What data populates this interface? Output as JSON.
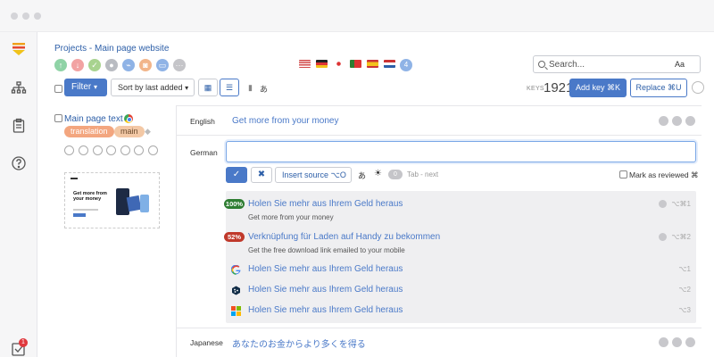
{
  "window": {
    "controls": [
      "close",
      "minimize",
      "maximize"
    ]
  },
  "rail": {
    "icons": [
      "logo-icon",
      "sitemap-icon",
      "clipboard-icon",
      "help-icon",
      "tasks-icon"
    ],
    "tasks_badge": "1"
  },
  "header": {
    "breadcrumb": "Projects - Main page website",
    "action_icons": [
      {
        "name": "upload-icon",
        "glyph": "↑",
        "color": "#8fd3a6"
      },
      {
        "name": "download-icon",
        "glyph": "↓",
        "color": "#f2a3a3"
      },
      {
        "name": "check-icon",
        "glyph": "✓",
        "color": "#a8d38f"
      },
      {
        "name": "user-icon",
        "glyph": "●",
        "color": "#b9bcc2"
      },
      {
        "name": "chart-icon",
        "glyph": "⌁",
        "color": "#8fb3e6"
      },
      {
        "name": "camera-icon",
        "glyph": "◙",
        "color": "#f2b58a"
      },
      {
        "name": "screen-icon",
        "glyph": "▭",
        "color": "#8fb3e6"
      },
      {
        "name": "more-icon",
        "glyph": "···",
        "color": "#c5c5c9"
      }
    ],
    "flags": [
      "us",
      "de",
      "jp",
      "pt",
      "es",
      "nl"
    ],
    "extra_languages": "4",
    "search": {
      "placeholder": "Search...",
      "case_label": "Aa"
    }
  },
  "toolbar": {
    "filter_label": "Filter",
    "sort_label": "Sort by last added",
    "keys_label": "KEYS",
    "keys_count": "1921",
    "add_key_label": "Add key ⌘K",
    "replace_label": "Replace ⌘U"
  },
  "key": {
    "name": "Main page text",
    "tags": [
      "translation",
      "main"
    ],
    "screenshot": {
      "heading": "Get more from your money"
    }
  },
  "translations": {
    "source": {
      "language": "English",
      "text": "Get more from your money"
    },
    "target": {
      "language": "German",
      "value": "",
      "insert_source_label": "Insert source ⌥O",
      "toggle_value": "0",
      "tab_hint": "Tab - next",
      "mark_reviewed_label": "Mark as reviewed ⌘"
    },
    "suggestions": [
      {
        "type": "tm",
        "match": "100%",
        "match_color": "#2e7d32",
        "text": "Holen Sie mehr aus Ihrem Geld heraus",
        "source": "Get more from your money",
        "shortcut": "⌥⌘1"
      },
      {
        "type": "tm",
        "match": "52%",
        "match_color": "#c0392b",
        "text": "Verknüpfung für Laden auf Handy zu bekommen",
        "source": "Get the free download link emailed to your mobile",
        "shortcut": "⌥⌘2"
      },
      {
        "type": "mt",
        "provider": "google-icon",
        "text": "Holen Sie mehr aus Ihrem Geld heraus",
        "shortcut": "⌥1"
      },
      {
        "type": "mt",
        "provider": "deepl-icon",
        "text": "Holen Sie mehr aus Ihrem Geld heraus",
        "shortcut": "⌥2"
      },
      {
        "type": "mt",
        "provider": "microsoft-icon",
        "text": "Holen Sie mehr aus Ihrem Geld heraus",
        "shortcut": "⌥3"
      }
    ],
    "japanese": {
      "language": "Japanese",
      "text": "あなたのお金からより多くを得る"
    }
  }
}
